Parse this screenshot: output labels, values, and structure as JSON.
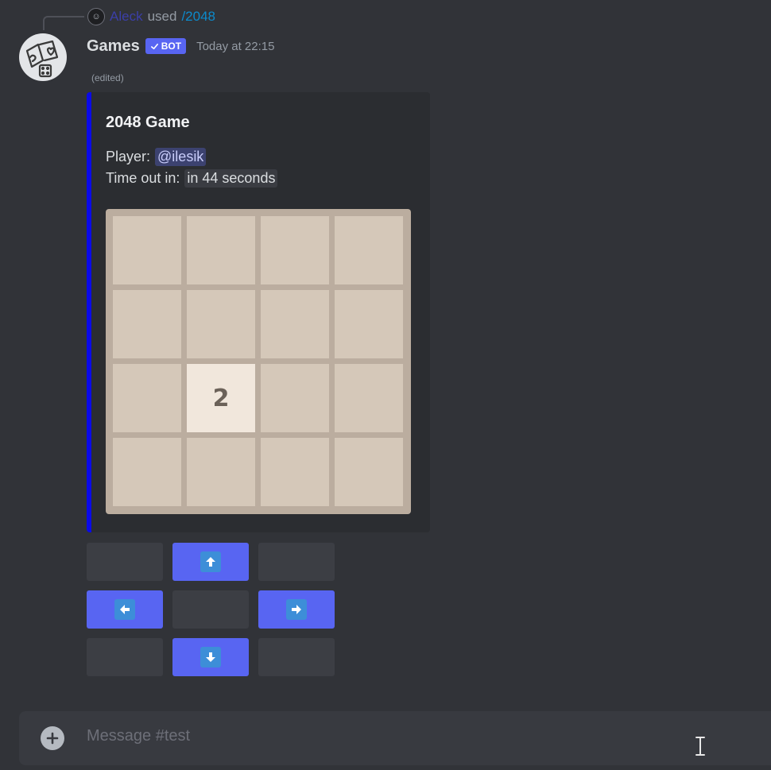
{
  "reply": {
    "username": "Aleck",
    "used_text": "used",
    "command": "/2048"
  },
  "message": {
    "username": "Games",
    "bot_tag": "BOT",
    "timestamp": "Today at 22:15",
    "edited": "(edited)"
  },
  "embed": {
    "accent_color": "#0a0ae8",
    "title": "2048 Game",
    "player_label": "Player:",
    "player_mention": "@ilesik",
    "timeout_label": "Time out in:",
    "timeout_value": "in 44 seconds"
  },
  "board": {
    "rows": [
      [
        "",
        "",
        "",
        ""
      ],
      [
        "",
        "",
        "",
        ""
      ],
      [
        "",
        "2",
        "",
        ""
      ],
      [
        "",
        "",
        "",
        ""
      ]
    ]
  },
  "buttons": {
    "up": "arrow-up-icon",
    "left": "arrow-left-icon",
    "right": "arrow-right-icon",
    "down": "arrow-down-icon",
    "primary_color": "#5865f2",
    "disabled_color": "#3c3e44"
  },
  "composer": {
    "placeholder": "Message #test"
  }
}
